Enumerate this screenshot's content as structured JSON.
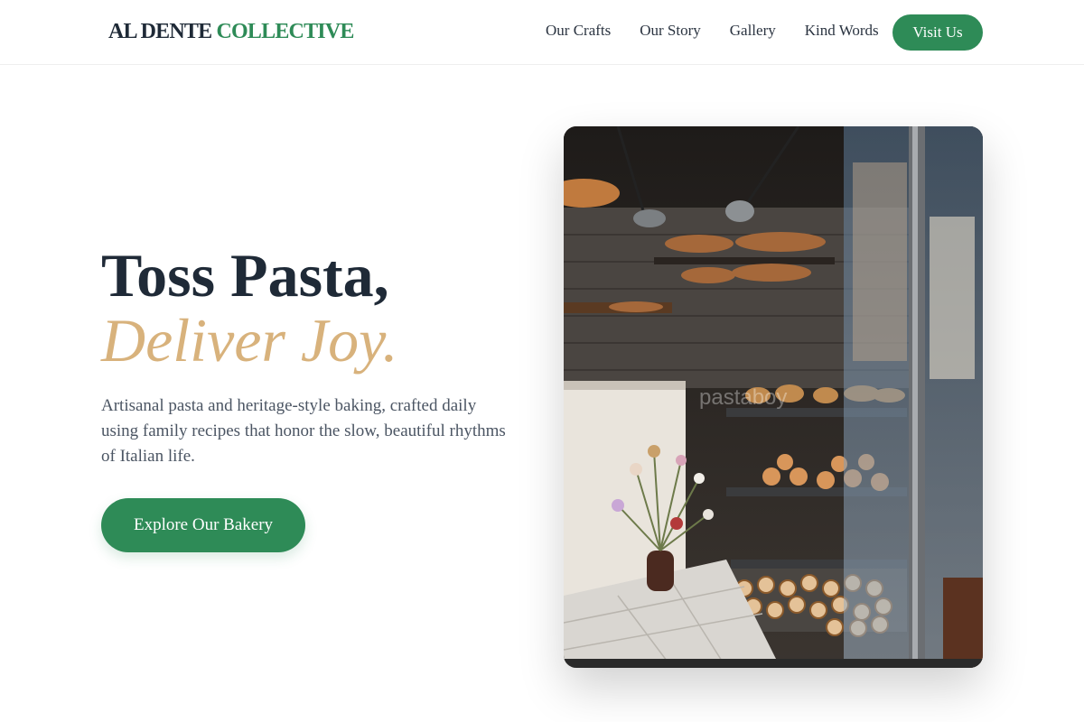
{
  "header": {
    "logo_part1": "AL DENTE",
    "logo_part2": "COLLECTIVE",
    "nav": [
      "Our Crafts",
      "Our Story",
      "Gallery",
      "Kind Words"
    ],
    "cta_label": "Visit Us"
  },
  "hero": {
    "headline_line1": "Toss Pasta,",
    "headline_line2": "Deliver Joy.",
    "description": "Artisanal pasta and heritage-style baking, crafted daily using family recipes that honor the slow, beautiful rhythms of Italian life.",
    "button_label": "Explore Our Bakery",
    "image_watermark": "pastaboy"
  },
  "colors": {
    "brand_green": "#2e8b57",
    "accent_gold": "#d8b27c",
    "text_dark": "#1f2a37",
    "text_muted": "#4b5563"
  },
  "icons": [
    "bakery-window-photo"
  ]
}
